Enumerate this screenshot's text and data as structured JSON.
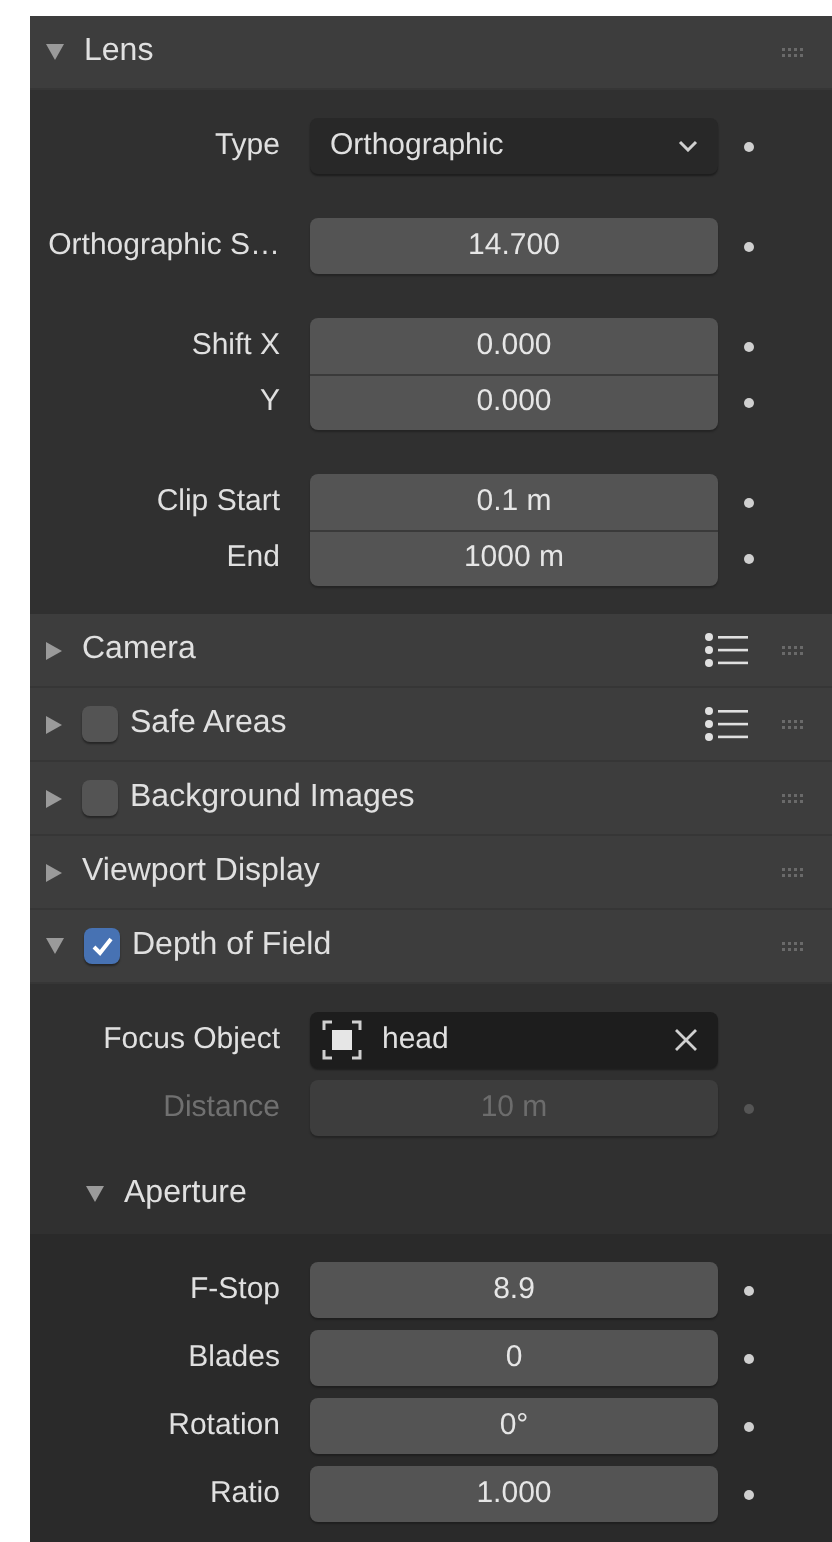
{
  "panels": [
    {
      "title": "Lens",
      "expanded": true,
      "kind": "plain",
      "preset_menu": false,
      "groups": [
        {
          "aligned": false,
          "rows": [
            {
              "kind": "dropdown",
              "label": "Type",
              "value": "Orthographic",
              "disabled": false
            }
          ]
        },
        {
          "aligned": false,
          "rows": [
            {
              "kind": "number",
              "label": "Orthographic S…",
              "value": "14.700",
              "disabled": false
            }
          ]
        },
        {
          "aligned": true,
          "rows": [
            {
              "kind": "number",
              "label": "Shift X",
              "value": "0.000",
              "disabled": false
            },
            {
              "kind": "number",
              "label": "Y",
              "value": "0.000",
              "disabled": false
            }
          ]
        },
        {
          "aligned": true,
          "rows": [
            {
              "kind": "number",
              "label": "Clip Start",
              "value": "0.1 m",
              "disabled": false
            },
            {
              "kind": "number",
              "label": "End",
              "value": "1000 m",
              "disabled": false
            }
          ]
        }
      ]
    },
    {
      "title": "Camera",
      "expanded": false,
      "kind": "plain",
      "preset_menu": true
    },
    {
      "title": "Safe Areas",
      "expanded": false,
      "kind": "toggle",
      "checked": false,
      "preset_menu": true
    },
    {
      "title": "Background Images",
      "expanded": false,
      "kind": "toggle",
      "checked": false,
      "preset_menu": false
    },
    {
      "title": "Viewport Display",
      "expanded": false,
      "kind": "plain",
      "preset_menu": false
    },
    {
      "title": "Depth of Field",
      "expanded": true,
      "kind": "toggle",
      "checked": true,
      "preset_menu": false,
      "groups": [
        {
          "aligned": false,
          "rows": [
            {
              "kind": "object",
              "label": "Focus Object",
              "value": "head",
              "disabled": false
            },
            {
              "kind": "number",
              "label": "Distance",
              "value": "10 m",
              "disabled": true
            }
          ]
        }
      ],
      "subpanels": [
        {
          "title": "Aperture",
          "expanded": true,
          "groups": [
            {
              "aligned": false,
              "rows": [
                {
                  "kind": "number",
                  "label": "F-Stop",
                  "value": "8.9",
                  "disabled": false
                },
                {
                  "kind": "number",
                  "label": "Blades",
                  "value": "0",
                  "disabled": false
                },
                {
                  "kind": "number",
                  "label": "Rotation",
                  "value": "0°",
                  "disabled": false
                },
                {
                  "kind": "number",
                  "label": "Ratio",
                  "value": "1.000",
                  "disabled": false
                }
              ]
            }
          ]
        }
      ]
    }
  ]
}
